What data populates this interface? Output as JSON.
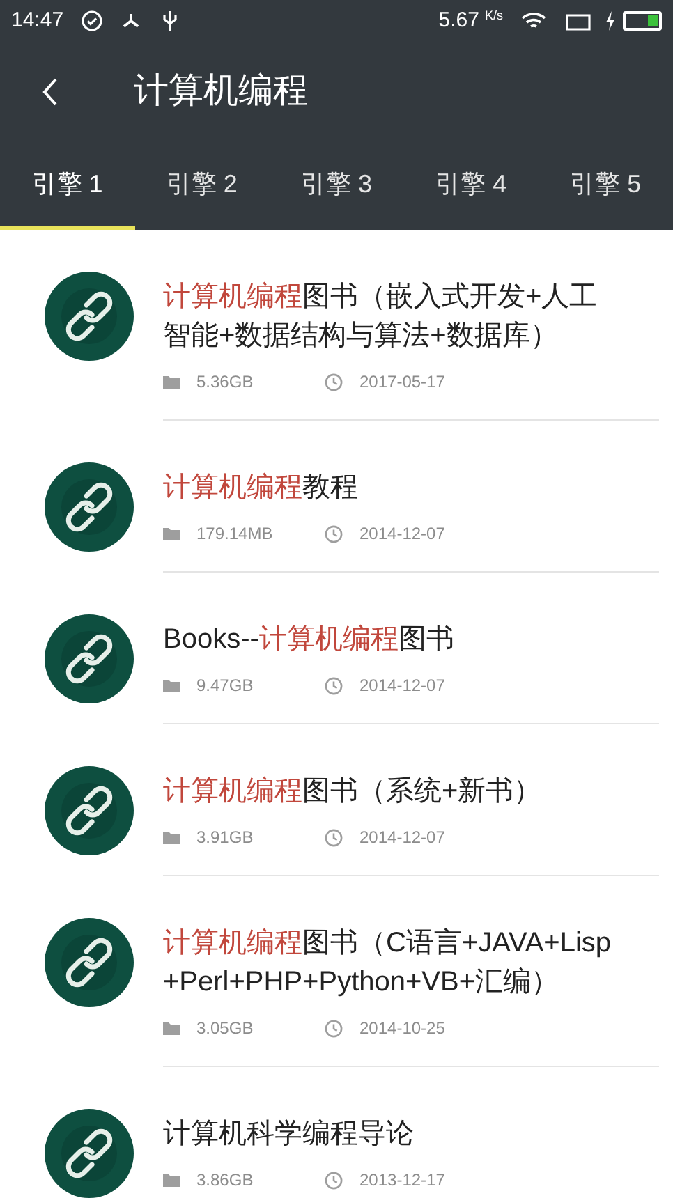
{
  "status_bar": {
    "time": "14:47",
    "speed": "5.67",
    "speed_unit": "K/s"
  },
  "header": {
    "title": "计算机编程"
  },
  "tabs": [
    {
      "label": "引擎 1",
      "selected": true
    },
    {
      "label": "引擎 2",
      "selected": false
    },
    {
      "label": "引擎 3",
      "selected": false
    },
    {
      "label": "引擎 4",
      "selected": false
    },
    {
      "label": "引擎 5",
      "selected": false
    }
  ],
  "results": [
    {
      "title_lines": [
        [
          {
            "text": "计算机编程",
            "highlight": true
          },
          {
            "text": "图书（嵌入式开发+人工",
            "highlight": false
          }
        ],
        [
          {
            "text": "智能+数据结构与算法+数据库）",
            "highlight": false
          }
        ]
      ],
      "size": "5.36GB",
      "date": "2017-05-17"
    },
    {
      "title_lines": [
        [
          {
            "text": "计算机编程",
            "highlight": true
          },
          {
            "text": "教程",
            "highlight": false
          }
        ]
      ],
      "size": "179.14MB",
      "date": "2014-12-07"
    },
    {
      "title_lines": [
        [
          {
            "text": "Books--",
            "highlight": false
          },
          {
            "text": "计算机编程",
            "highlight": true
          },
          {
            "text": "图书",
            "highlight": false
          }
        ]
      ],
      "size": "9.47GB",
      "date": "2014-12-07"
    },
    {
      "title_lines": [
        [
          {
            "text": "计算机编程",
            "highlight": true
          },
          {
            "text": "图书（系统+新书）",
            "highlight": false
          }
        ]
      ],
      "size": "3.91GB",
      "date": "2014-12-07"
    },
    {
      "title_lines": [
        [
          {
            "text": "计算机编程",
            "highlight": true
          },
          {
            "text": "图书（C语言+JAVA+Lisp",
            "highlight": false
          }
        ],
        [
          {
            "text": "+Perl+PHP+Python+VB+汇编）",
            "highlight": false
          }
        ]
      ],
      "size": "3.05GB",
      "date": "2014-10-25"
    },
    {
      "title_lines": [
        [
          {
            "text": "计算机科学编程导论",
            "highlight": false
          }
        ]
      ],
      "size": "3.86GB",
      "date": "2013-12-17"
    }
  ]
}
